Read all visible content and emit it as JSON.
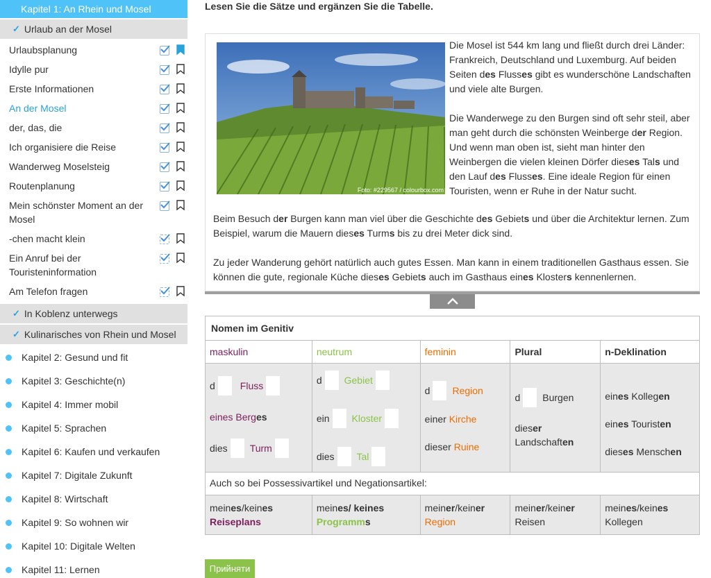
{
  "sidebar": {
    "active_chapter": "Kapitel 1: An Rhein und Mosel",
    "sections": [
      {
        "label": "Urlaub an der Mosel"
      },
      {
        "label": "In Koblenz unterwegs"
      },
      {
        "label": "Kulinarisches von Rhein und Mosel"
      }
    ],
    "lessons": [
      {
        "label": "Urlaubsplanung",
        "bookmark": "filled"
      },
      {
        "label": "Idylle pur"
      },
      {
        "label": "Erste Informationen"
      },
      {
        "label": "An der Mosel",
        "active": true
      },
      {
        "label": "der, das, die"
      },
      {
        "label": "Ich organisiere die Reise"
      },
      {
        "label": "Wanderweg Moselsteig"
      },
      {
        "label": "Routenplanung"
      },
      {
        "label": "Mein schönster Moment an der Mosel"
      },
      {
        "label": "-chen macht klein"
      },
      {
        "label": "Ein Anruf bei der Touristeninformation"
      },
      {
        "label": "Am Telefon fragen"
      }
    ],
    "chapters": [
      "Kapitel 2: Gesund und fit",
      "Kapitel 3: Geschichte(n)",
      "Kapitel 4: Immer mobil",
      "Kapitel 5: Sprachen",
      "Kapitel 6: Kaufen und verkaufen",
      "Kapitel 7: Digitale Zukunft",
      "Kapitel 8: Wirtschaft",
      "Kapitel 9: So wohnen wir",
      "Kapitel 10: Digitale Welten",
      "Kapitel 11: Lernen"
    ]
  },
  "main": {
    "instruction": "Lesen Sie die Sätze und ergänzen Sie die Tabelle.",
    "photo_credit": "Foto: #229567 / colourbox.com",
    "accept_label": "Прийняти"
  },
  "table": {
    "title": "Nomen im Genitiv",
    "headers": {
      "mask": "maskulin",
      "neut": "neutrum",
      "fem": "feminin",
      "plural": "Plural",
      "ndekl": "n-Deklination"
    },
    "mask_words": [
      "Fluss",
      "eines Berg",
      "es",
      "Turm"
    ],
    "neut_words": [
      "Gebiet",
      "Kloster",
      "Tal"
    ],
    "fem_words": [
      "Region",
      "einer ",
      "Kirche",
      "dieser ",
      "Ruine"
    ],
    "plural_words": [
      "Burgen",
      "dies",
      "er",
      " Landschaft",
      "en"
    ],
    "ndekl_words": [
      "ein",
      "es",
      " Kolleg",
      "en",
      "ein",
      "es",
      " Tourist",
      "en",
      "dies",
      "es",
      " Mensch",
      "en"
    ],
    "note": "Auch so bei Possessivartikel und Negationsartikel:",
    "foot": {
      "mask": [
        "mein",
        "es",
        "/kein",
        "es",
        "Reiseplans"
      ],
      "neut": [
        "mein",
        "es",
        "/ kein",
        "es",
        "Programm",
        "s"
      ],
      "fem": [
        "mein",
        "er",
        "/kein",
        "er",
        "Region"
      ],
      "plural": [
        "mein",
        "er",
        "/kein",
        "er",
        "Reisen"
      ],
      "ndekl": [
        "mein",
        "es",
        "/kein",
        "es",
        "Kollegen"
      ]
    }
  },
  "colors": {
    "accent": "#4fc3f7",
    "maskulin": "#7b1f5c",
    "neutrum": "#8bc34a",
    "feminin": "#ef6c00",
    "accept": "#8bc34a"
  }
}
